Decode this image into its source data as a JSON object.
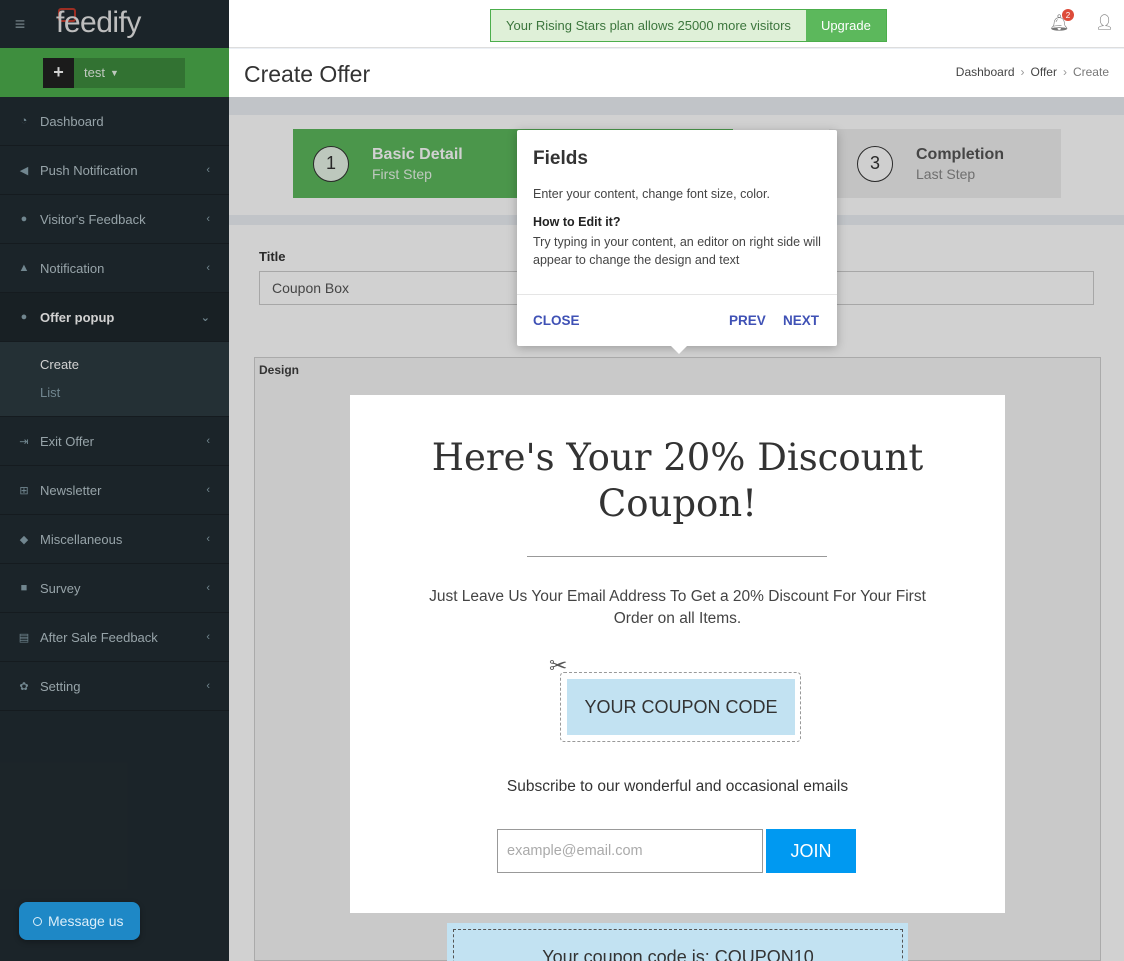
{
  "app": {
    "logo": "feedify"
  },
  "project": {
    "name": "test"
  },
  "plan": {
    "text": "Your Rising Stars plan allows 25000 more visitors",
    "upgrade_label": "Upgrade"
  },
  "notifications": {
    "count": "2"
  },
  "sidebar": {
    "items": [
      {
        "label": "Dashboard",
        "icon": "dashboard-icon"
      },
      {
        "label": "Push Notification",
        "icon": "bullhorn-icon"
      },
      {
        "label": "Visitor's Feedback",
        "icon": "users-icon"
      },
      {
        "label": "Notification",
        "icon": "bell-icon"
      },
      {
        "label": "Offer popup",
        "icon": "comment-icon"
      },
      {
        "label": "Exit Offer",
        "icon": "sign-out-icon"
      },
      {
        "label": "Newsletter",
        "icon": "plus-square-icon"
      },
      {
        "label": "Miscellaneous",
        "icon": "tag-icon"
      },
      {
        "label": "Survey",
        "icon": "cubes-icon"
      },
      {
        "label": "After Sale Feedback",
        "icon": "cart-icon"
      },
      {
        "label": "Setting",
        "icon": "gear-icon"
      }
    ],
    "submenu": [
      "Create",
      "List"
    ]
  },
  "message_button": {
    "label": "Message us"
  },
  "page": {
    "title": "Create Offer"
  },
  "breadcrumb": [
    "Dashboard",
    "Offer",
    "Create"
  ],
  "steps": [
    {
      "num": "1",
      "title": "Basic Detail",
      "sub": "First Step"
    },
    {
      "num": "3",
      "title": "Completion",
      "sub": "Last Step"
    }
  ],
  "form": {
    "title_label": "Title",
    "title_value": "Coupon Box",
    "design_label": "Design"
  },
  "popup": {
    "heading": "Here's Your 20% Discount Coupon!",
    "description": "Just Leave Us Your Email Address To Get a 20% Discount For Your First Order on all Items.",
    "coupon_label": "YOUR COUPON CODE",
    "subscribe": "Subscribe to our wonderful and occasional emails",
    "email_placeholder": "example@email.com",
    "join_label": "JOIN",
    "coupon_result": "Your coupon code is: COUPON10"
  },
  "tooltip": {
    "title": "Fields",
    "text": "Enter your content, change font size, color.",
    "how_title": "How to Edit it?",
    "how_body": "Try typing in your content, an editor on right side will appear to change the design and text",
    "close": "CLOSE",
    "prev": "PREV",
    "next": "NEXT"
  },
  "colors": {
    "sidebar": "#222d32",
    "green": "#5cb85c",
    "blue_btn": "#0099f1",
    "coupon_bg": "#c2e2f2",
    "link": "#3f51b5"
  }
}
